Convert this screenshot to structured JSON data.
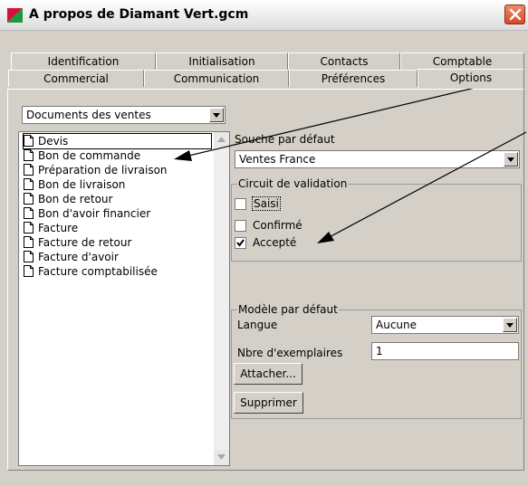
{
  "window": {
    "title": "A propos de Diamant Vert.gcm"
  },
  "tabs_row1": [
    "Identification",
    "Initialisation",
    "Contacts",
    "Comptable"
  ],
  "tabs_row2": [
    "Commercial",
    "Communication",
    "Préférences",
    "Options"
  ],
  "active_tab": "Options",
  "document_type": {
    "selected": "Documents des ventes"
  },
  "documents": [
    "Devis",
    "Bon de commande",
    "Préparation de livraison",
    "Bon de livraison",
    "Bon de retour",
    "Bon d'avoir financier",
    "Facture",
    "Facture de retour",
    "Facture d'avoir",
    "Facture comptabilisée"
  ],
  "souche": {
    "label": "Souche par défaut",
    "selected": "Ventes France"
  },
  "circuit": {
    "title": "Circuit de validation",
    "items": [
      {
        "label": "Saisi",
        "checked": false
      },
      {
        "label": "Confirmé",
        "checked": false
      },
      {
        "label": "Accepté",
        "checked": true
      }
    ]
  },
  "modele": {
    "title": "Modèle par défaut",
    "langue_label": "Langue",
    "langue_value": "Aucune",
    "exemplaires_label": "Nbre d'exemplaires",
    "exemplaires_value": "1",
    "attach_label": "Attacher...",
    "delete_label": "Supprimer"
  },
  "colors": {
    "selection_border": "#000000",
    "accent": "#d6103a"
  }
}
